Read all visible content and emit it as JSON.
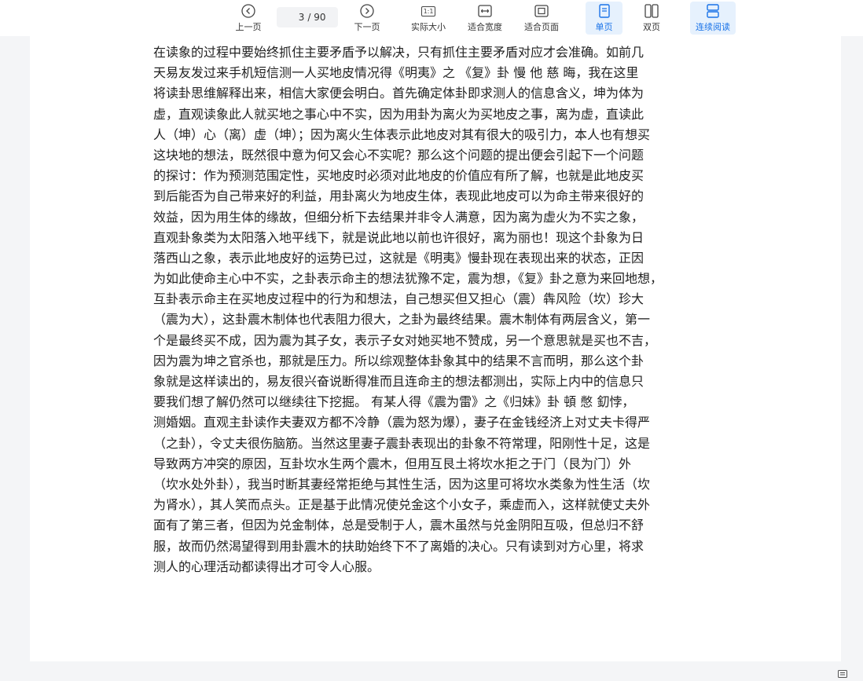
{
  "toolbar": {
    "prev_label": "上一页",
    "next_label": "下一页",
    "page_current": "3",
    "page_total": "/ 90",
    "actual_size_label": "实际大小",
    "actual_size_glyph": "1:1",
    "fit_width_label": "适合宽度",
    "fit_page_label": "适合页面",
    "single_page_label": "单页",
    "double_page_label": "双页",
    "continuous_label": "连续阅读",
    "accent_color": "#1a73e8",
    "active_bg": "#e6f1fd"
  },
  "document": {
    "lines": [
      "在读象的过程中要始终抓住主要矛盾予以解决，只有抓住主要矛盾对应才会准确。如前几",
      "天易友发过来手机短信测一人买地皮情况得《明夷》之 《复》卦 慢 他 慈 晦，我在这里",
      "将读卦思维解释出来，相信大家便会明白。首先确定体卦即求测人的信息含义，坤为体为",
      "虚，直观读象此人就买地之事心中不实，因为用卦为离火为买地皮之事，离为虚，直读此",
      "人（坤）心（离）虚（坤）；因为离火生体表示此地皮对其有很大的吸引力，本人也有想买",
      "这块地的想法，既然很中意为何又会心不实呢？那么这个问题的提出便会引起下一个问题",
      "的探讨：作为预测范围定性，买地皮时必须对此地皮的价值应有所了解，也就是此地皮买",
      "到后能否为自己带来好的利益，用卦离火为地皮生体，表现此地皮可以为命主带来很好的",
      "效益，因为用生体的缘故，但细分析下去结果并非令人满意，因为离为虚火为不实之象，",
      "直观卦象类为太阳落入地平线下，就是说此地以前也许很好，离为丽也！现这个卦象为日",
      "落西山之象，表示此地皮好的运势已过，这就是《明夷》慢卦现在表现出来的状态，正因",
      "为如此使命主心中不实，之卦表示命主的想法犹豫不定，震为想，《复》卦之意为来回地想，",
      "互卦表示命主在买地皮过程中的行为和想法，自己想买但又担心（震）犇风险（坎）珍大",
      "（震为大），这卦震木制体也代表阻力很大，之卦为最终结果。震木制体有两层含义，第一",
      "个是最终买不成，因为震为其子女，表示子女对她买地不赞成，另一个意思就是买也不吉，",
      "因为震为坤之官杀也，那就是压力。所以综观整体卦象其中的结果不言而明，那么这个卦",
      "象就是这样读出的，易友很兴奋说断得准而且连命主的想法都测出，实际上内中的信息只",
      "要我们想了解仍然可以继续往下挖掘。  有某人得《震为雷》之《归妹》卦 頓 憋 釖悖，",
      "测婚姻。直观主卦读作夫妻双方都不冷静（震为怒为爆），妻子在金钱经济上对丈夫卡得严",
      "（之卦），令丈夫很伤脑筋。当然这里妻子震卦表现出的卦象不符常理，阳刚性十足，这是",
      "导致两方冲突的原因，互卦坎水生两个震木，但用互艮土将坎水拒之于门（艮为门）外",
      "（坎水处外卦），我当时断其妻经常拒绝与其性生活，因为这里可将坎水类象为性生活（坎",
      "为肾水），其人笑而点头。正是基于此情况使兑金这个小女子，乘虚而入，这样就使丈夫外",
      "面有了第三者，但因为兑金制体，总是受制于人，震木虽然与兑金阴阳互吸，但总归不舒",
      "服，故而仍然渴望得到用卦震木的扶助始终下不了离婚的决心。只有读到对方心里，将求",
      "测人的心理活动都读得出才可令人心服。"
    ]
  }
}
